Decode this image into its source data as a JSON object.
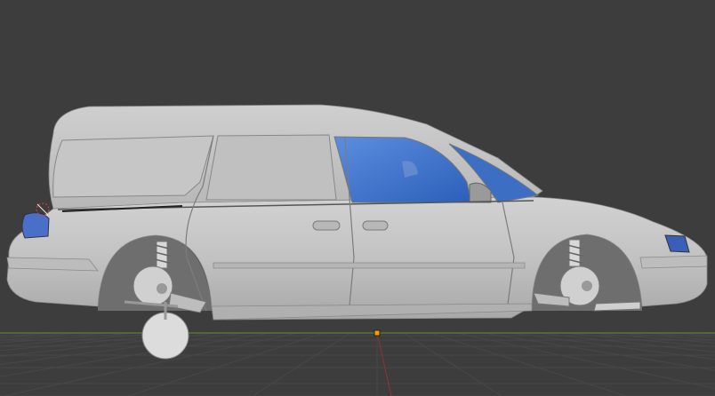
{
  "viewport": {
    "background": "#3d3d3d",
    "grid_color": "#474747",
    "x_axis_color": "#7a2f2f",
    "y_axis_color": "#55732f",
    "origin_color": "#f5a000"
  },
  "model": {
    "body_color": "#c4c4c4",
    "glass_color": "#3f73c9",
    "taillight_color": "#4a6fc9",
    "headlight_color": "#3a5fb8"
  }
}
